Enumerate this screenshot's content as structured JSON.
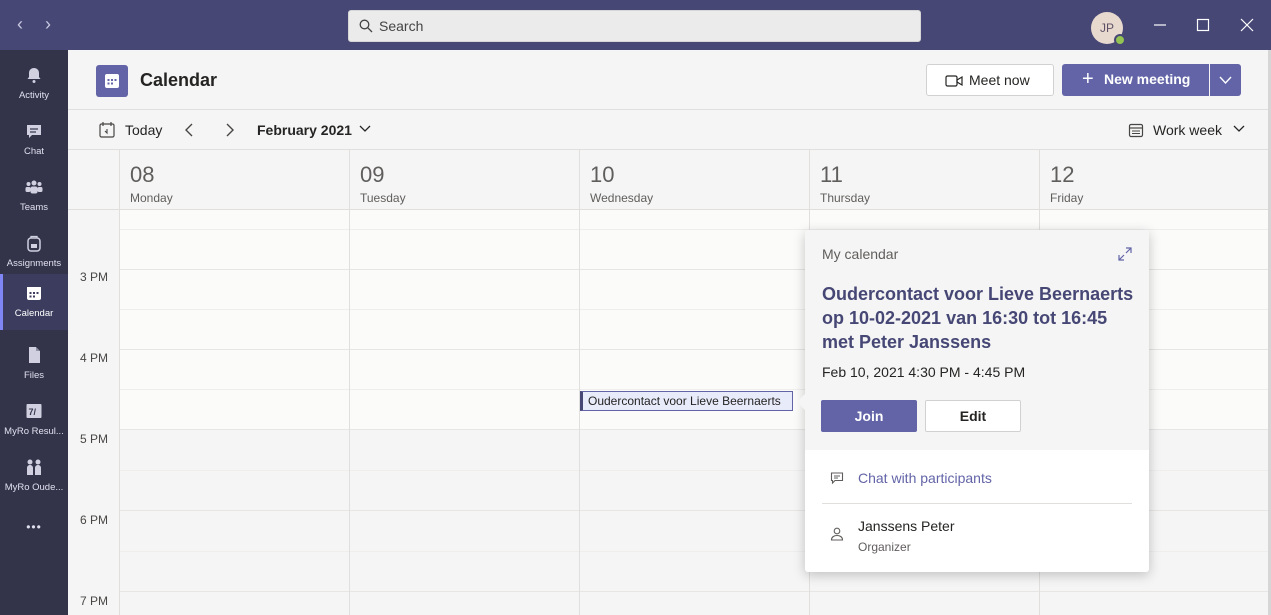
{
  "titlebar": {
    "search_placeholder": "Search",
    "avatar_initials": "JP",
    "presence_color": "#92c353"
  },
  "rail": {
    "items": [
      {
        "label": "Activity",
        "icon": "bell-icon"
      },
      {
        "label": "Chat",
        "icon": "chat-icon"
      },
      {
        "label": "Teams",
        "icon": "teams-icon"
      },
      {
        "label": "Assignments",
        "icon": "backpack-icon"
      },
      {
        "label": "Calendar",
        "icon": "calendar-icon",
        "active": true
      },
      {
        "label": "Files",
        "icon": "file-icon"
      },
      {
        "label": "MyRo Resul...",
        "icon": "myro-results-icon"
      },
      {
        "label": "MyRo Oude...",
        "icon": "myro-parents-icon"
      },
      {
        "label": "•••",
        "icon": "more-icon"
      }
    ]
  },
  "header": {
    "title": "Calendar",
    "meet_now_label": "Meet now",
    "new_meeting_label": "New meeting"
  },
  "toolbar": {
    "today_label": "Today",
    "month_label": "February 2021",
    "view_label": "Work week"
  },
  "days": [
    {
      "num": "08",
      "name": "Monday"
    },
    {
      "num": "09",
      "name": "Tuesday"
    },
    {
      "num": "10",
      "name": "Wednesday"
    },
    {
      "num": "11",
      "name": "Thursday"
    },
    {
      "num": "12",
      "name": "Friday"
    }
  ],
  "times": [
    "3 PM",
    "4 PM",
    "5 PM",
    "6 PM",
    "7 PM"
  ],
  "event": {
    "title": "Oudercontact voor Lieve Beernaerts"
  },
  "popup": {
    "calendar_label": "My calendar",
    "title": "Oudercontact voor Lieve Beernaerts op 10-02-2021 van 16:30 tot 16:45 met Peter Janssens",
    "time": "Feb 10, 2021 4:30 PM - 4:45 PM",
    "join_label": "Join",
    "edit_label": "Edit",
    "chat_label": "Chat with participants",
    "organizer_name": "Janssens Peter",
    "organizer_role": "Organizer"
  },
  "colors": {
    "brand": "#6264a7",
    "titlebar": "#464775",
    "rail": "#33344a"
  }
}
